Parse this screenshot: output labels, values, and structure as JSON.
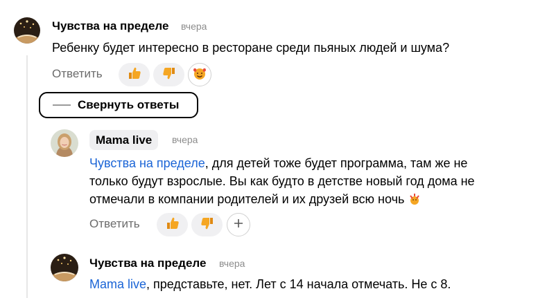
{
  "comments": [
    {
      "author": "Чувства на пределе",
      "time": "вчера",
      "text": "Ребенку будет интересно в ресторане среди пьяных людей и шума?",
      "reply_label": "Ответить"
    },
    {
      "author": "Mama live",
      "time": "вчера",
      "mention": "Чувства на пределе",
      "text_line1": ", для детей тоже будет программа, там же не",
      "text_line2": "только будут взрослые. Вы как будто в детстве новый год дома не",
      "text_line3": "отмечали в компании родителей и их друзей всю ночь",
      "reply_label": "Ответить"
    },
    {
      "author": "Чувства на пределе",
      "time": "вчера",
      "mention": "Mama live",
      "text": ", представьте, нет. Лет с 14 начала отмечать. Не с 8."
    }
  ],
  "collapse_label": "Свернуть ответы",
  "icons": {
    "like": "thumbs-up-icon",
    "dislike": "thumbs-down-icon",
    "love": "heart-face-icon",
    "add": "plus-icon"
  },
  "colors": {
    "mention": "#1a64d6",
    "chip_bg": "#efeff1",
    "reaction_bg": "#f0f0f2",
    "thumb": "#f5a623"
  }
}
